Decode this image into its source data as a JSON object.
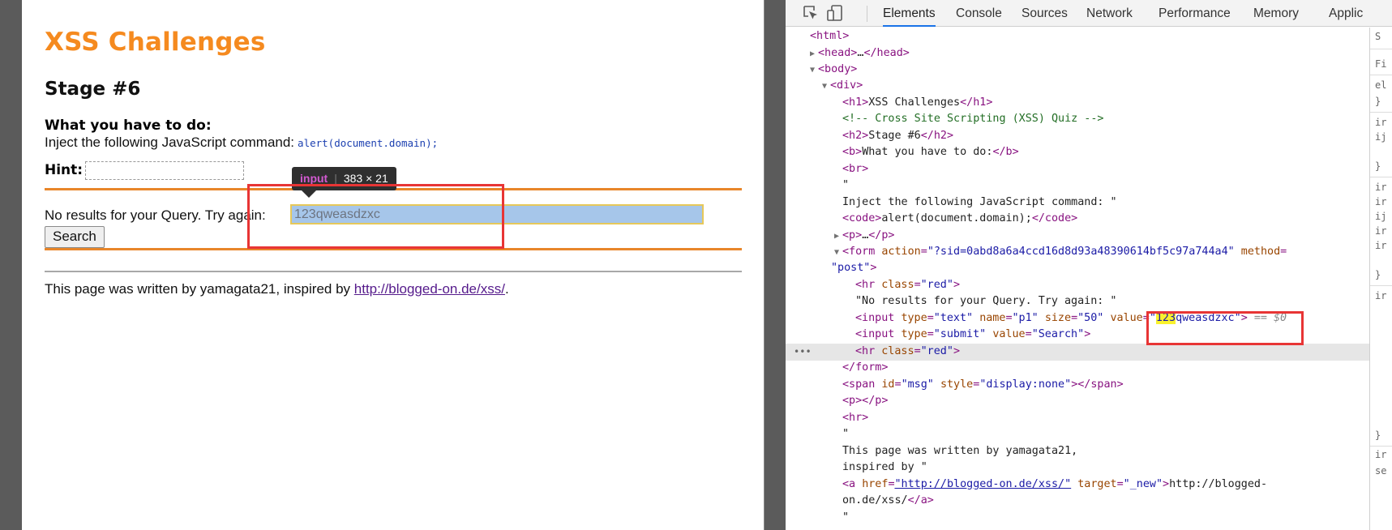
{
  "page": {
    "title": "XSS Challenges",
    "stage": "Stage #6",
    "todo_label": "What you have to do:",
    "inject_text": "Inject the following JavaScript command:",
    "inject_code": "alert(document.domain);",
    "hint_label": "Hint:",
    "no_results_text": "No results for your Query. Try again:",
    "query_value": "123qweasdzxc",
    "search_button": "Search",
    "footer_text": "This page was written by yamagata21, inspired by",
    "footer_link": "http://blogged-on.de/xss/",
    "footer_end": "."
  },
  "tooltip": {
    "tag": "input",
    "size": "383 × 21"
  },
  "devtools": {
    "tabs": [
      "Elements",
      "Console",
      "Sources",
      "Network",
      "Performance",
      "Memory",
      "Applic"
    ],
    "active_tab": "Elements",
    "lines": {
      "l_html": "<html>",
      "l_head_open": "<head>",
      "l_head_ellipsis": "…",
      "l_head_close": "</head>",
      "l_body": "<body>",
      "l_div": "<div>",
      "l_h1_open": "<h1>",
      "l_h1_text": "XSS Challenges",
      "l_h1_close": "</h1>",
      "l_comment": "<!-- Cross Site Scripting (XSS) Quiz -->",
      "l_h2_open": "<h2>",
      "l_h2_text": "Stage #6",
      "l_h2_close": "</h2>",
      "l_b_open": "<b>",
      "l_b_text": "What you have to do:",
      "l_b_close": "</b>",
      "l_br": "<br>",
      "l_quote1": "\"",
      "l_inject": "Inject the following JavaScript command: \"",
      "l_code_open": "<code>",
      "l_code_text": "alert(document.domain);",
      "l_code_close": "</code>",
      "l_p_open": "<p>",
      "l_p_ellipsis": "…",
      "l_p_close": "</p>",
      "l_form_tag": "<form",
      "l_form_action_attr": "action",
      "l_form_action_val": "\"?sid=0abd8a6a4ccd16d8d93a48390614bf5c97a744a4\"",
      "l_form_method_attr": "method",
      "l_form_method_val": "\"post\"",
      "l_form_end": ">",
      "l_hr_tag": "<hr",
      "l_hr_class_attr": "class",
      "l_hr_class_val": "\"red\"",
      "l_tag_close": ">",
      "l_noresults": "\"No results for your Query. Try again: \"",
      "l_input_tag": "<input",
      "l_type_attr": "type",
      "l_type_text_val": "\"text\"",
      "l_name_attr": "name",
      "l_name_val": "\"p1\"",
      "l_size_attr": "size",
      "l_size_val": "\"50\"",
      "l_value_attr": "value",
      "l_value_q1": "\"",
      "l_value_hl": "123",
      "l_value_rest": "qweasdzxc\"",
      "l_input_end": ">",
      "l_eq0": "== $0",
      "l_submit_type_val": "\"submit\"",
      "l_submit_value_val": "\"Search\"",
      "l_form_close": "</form>",
      "l_span_tag": "<span",
      "l_id_attr": "id",
      "l_id_val": "\"msg\"",
      "l_style_attr": "style",
      "l_style_val": "\"display:none\"",
      "l_span_close": "></span>",
      "l_p_empty": "<p></p>",
      "l_hr": "<hr>",
      "l_quote2": "\"",
      "l_written": "This page was written by yamagata21,",
      "l_inspired": "inspired by \"",
      "l_a_tag": "<a",
      "l_href_attr": "href",
      "l_href_val": "\"http://blogged-on.de/xss/\"",
      "l_target_attr": "target",
      "l_target_val": "\"_new\"",
      "l_a_text1": "http://blogged-",
      "l_a_text2": "on.de/xss/",
      "l_a_close": "</a>",
      "l_quote3": "\""
    },
    "styles_pane": [
      "S",
      "Fi",
      "el",
      "}",
      "ir",
      "ij",
      "}",
      "ir",
      "ir",
      "ij",
      "ir",
      "ir",
      "}",
      "ir",
      "}",
      "ir",
      "se"
    ]
  },
  "colors": {
    "title": "#f58a1f",
    "hr_orange": "#e8862a",
    "annotation_red": "#e83535",
    "devtools_tag": "#881280",
    "devtools_attr": "#994500",
    "devtools_value": "#1a1aa6"
  }
}
